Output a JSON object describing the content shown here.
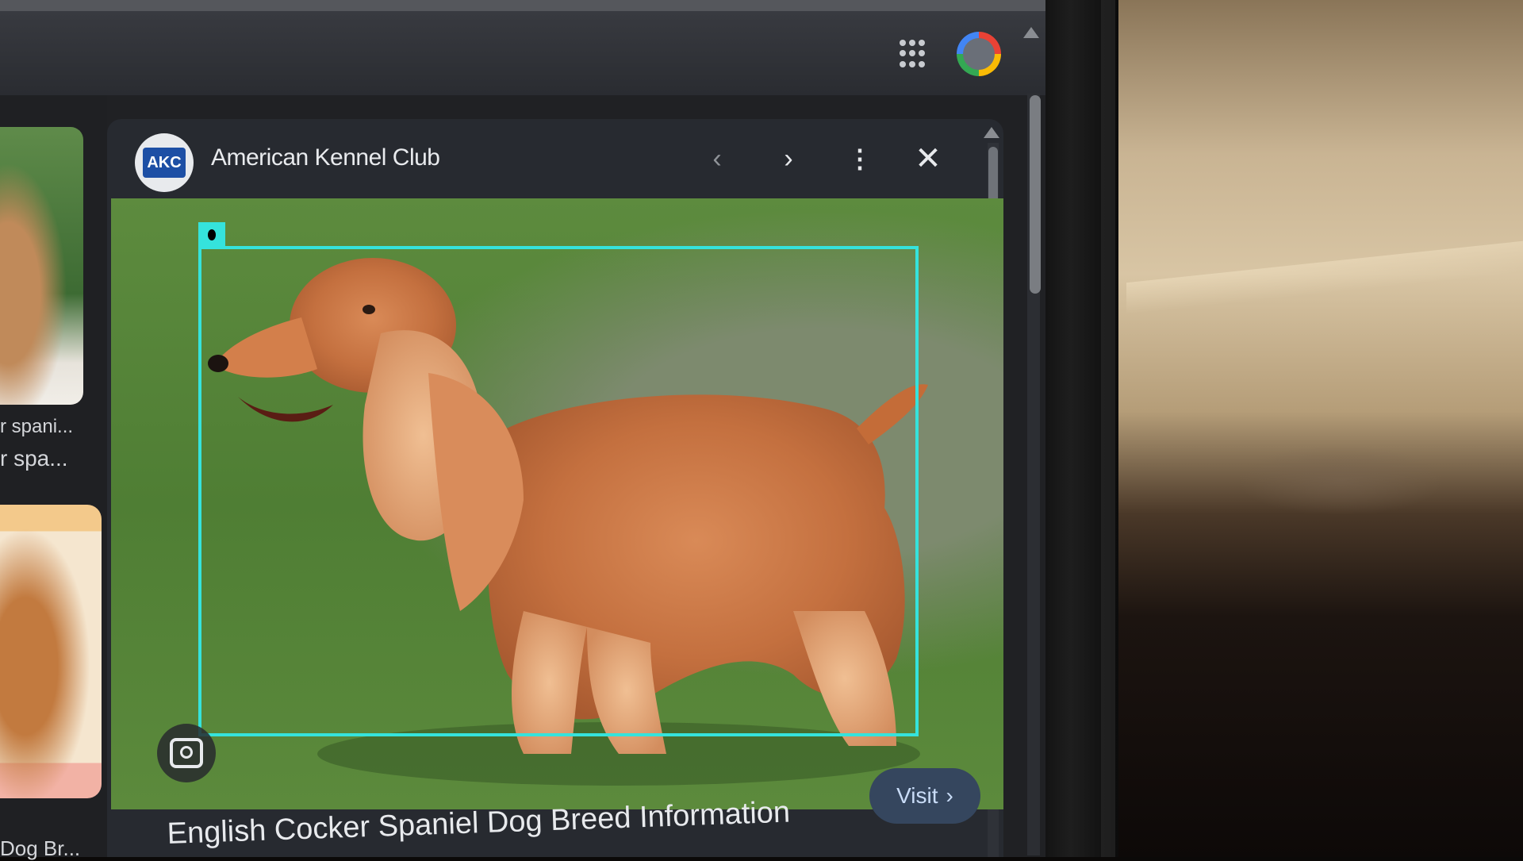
{
  "browser": {
    "apps_icon": "apps-grid-icon",
    "account_icon": "account-avatar-icon"
  },
  "results": [
    {
      "title": "r spani...",
      "subtitle": "r spa..."
    },
    {
      "title": "Dog Br..."
    }
  ],
  "preview": {
    "source_logo_text": "AKC",
    "source_name": "American Kennel Club",
    "prev_icon": "chevron-left-icon",
    "next_icon": "chevron-right-icon",
    "more_icon": "more-vert-icon",
    "close_icon": "close-icon",
    "lens_icon": "lens-search-icon",
    "visit_label": "Visit",
    "visit_icon": "chevron-right-icon",
    "page_title": "English Cocker Spaniel Dog Breed Information"
  },
  "colors": {
    "selection": "#35e3dc",
    "visit_button": "#35465e"
  }
}
